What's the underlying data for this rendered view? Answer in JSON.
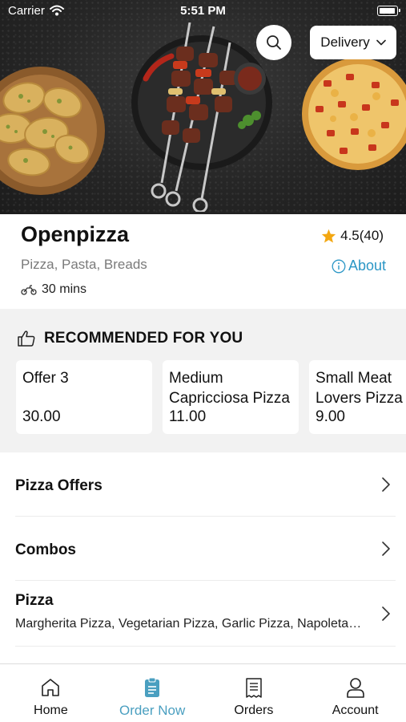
{
  "status_bar": {
    "carrier": "Carrier",
    "time": "5:51 PM"
  },
  "hero": {
    "delivery_mode": "Delivery",
    "search_icon": "search-icon"
  },
  "store": {
    "name": "Openpizza",
    "rating": "4.5(40)",
    "cuisines": "Pizza, Pasta, Breads",
    "about_label": "About",
    "delivery_time": "30 mins"
  },
  "recommended": {
    "title": "RECOMMENDED FOR YOU",
    "items": [
      {
        "name": "Offer 3",
        "price": "30.00"
      },
      {
        "name": "Medium Capricciosa Pizza",
        "price": "11.00"
      },
      {
        "name": "Small Meat Lovers Pizza",
        "price": "9.00"
      }
    ]
  },
  "categories": [
    {
      "name": "Pizza Offers",
      "description": ""
    },
    {
      "name": "Combos",
      "description": ""
    },
    {
      "name": "Pizza",
      "description": "Margherita Pizza, Vegetarian Pizza, Garlic Pizza, Napoletana Pizza"
    }
  ],
  "tabs": [
    {
      "label": "Home",
      "icon": "home-icon",
      "active": false
    },
    {
      "label": "Order Now",
      "icon": "order-icon",
      "active": true
    },
    {
      "label": "Orders",
      "icon": "receipt-icon",
      "active": false
    },
    {
      "label": "Account",
      "icon": "account-icon",
      "active": false
    }
  ],
  "colors": {
    "accent": "#2c97c6",
    "active_tab": "#4a9fc0",
    "star": "#f3a712",
    "section_bg": "#f2f2f2"
  }
}
